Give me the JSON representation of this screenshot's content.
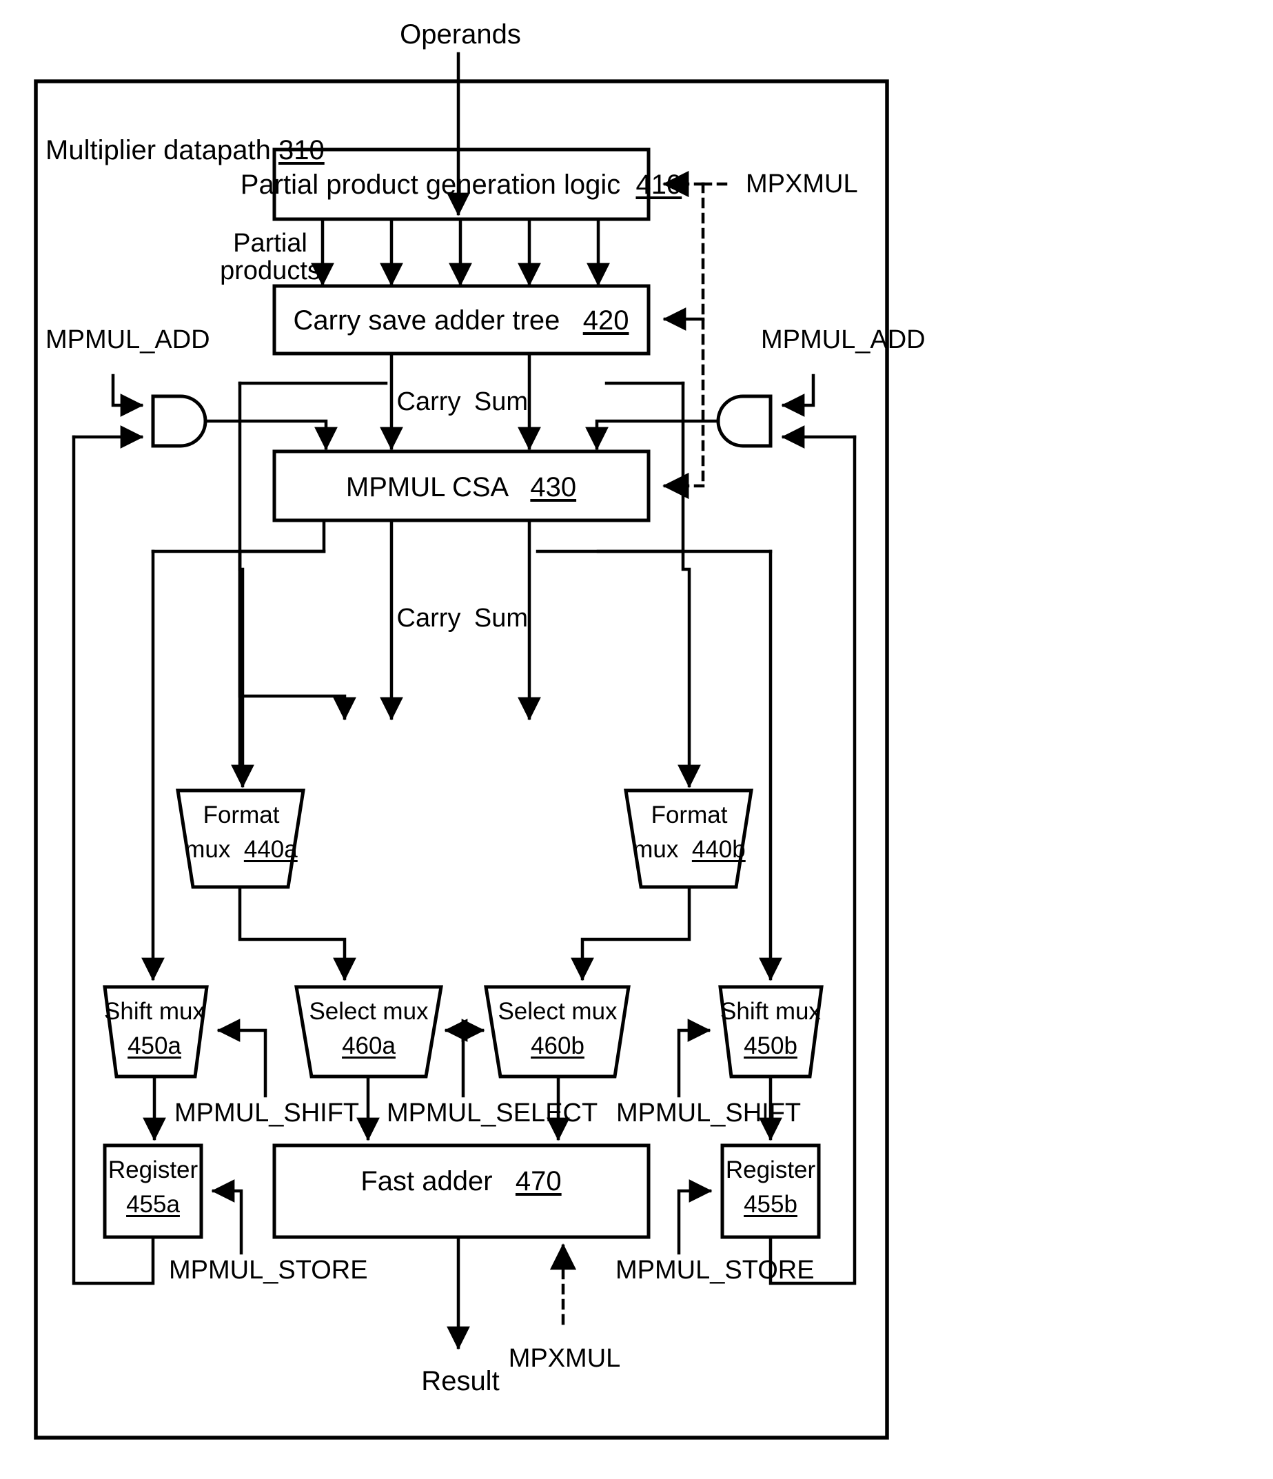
{
  "figure": {
    "title_block_label": "Multiplier datapath 310",
    "outer_label_text": "Multiplier datapath",
    "outer_label_ref": "310",
    "input_label": "Operands",
    "output_label": "Result"
  },
  "blocks": {
    "ppg": {
      "text": "Partial product generation logic",
      "ref": "410",
      "shape": "rect"
    },
    "csa_tree": {
      "text": "Carry save adder tree",
      "ref": "420",
      "shape": "rect"
    },
    "mpmul_csa": {
      "text": "MPMUL CSA",
      "ref": "430",
      "shape": "rect"
    },
    "format_mux_a": {
      "line1": "Format",
      "line2": "mux",
      "ref": "440a",
      "shape": "trapezoid"
    },
    "format_mux_b": {
      "line1": "Format",
      "line2": "mux",
      "ref": "440b",
      "shape": "trapezoid"
    },
    "shift_mux_a": {
      "line1": "Shift mux",
      "ref": "450a",
      "shape": "trapezoid"
    },
    "shift_mux_b": {
      "line1": "Shift mux",
      "ref": "450b",
      "shape": "trapezoid"
    },
    "select_mux_a": {
      "line1": "Select mux",
      "ref": "460a",
      "shape": "trapezoid"
    },
    "select_mux_b": {
      "line1": "Select mux",
      "ref": "460b",
      "shape": "trapezoid"
    },
    "register_a": {
      "line1": "Register",
      "ref": "455a",
      "shape": "rect"
    },
    "register_b": {
      "line1": "Register",
      "ref": "455b",
      "shape": "rect"
    },
    "fast_adder": {
      "text": "Fast adder",
      "ref": "470",
      "shape": "rect"
    },
    "and_gate_a": {
      "shape": "and-gate"
    },
    "and_gate_b": {
      "shape": "and-gate"
    }
  },
  "signals": {
    "mpxmul_top": "MPXMUL",
    "mpxmul_bottom": "MPXMUL",
    "mpmul_add_left": "MPMUL_ADD",
    "mpmul_add_right": "MPMUL_ADD",
    "mpmul_shift_left": "MPMUL_SHIFT",
    "mpmul_shift_right": "MPMUL_SHIFT",
    "mpmul_select": "MPMUL_SELECT",
    "mpmul_store_left": "MPMUL_STORE",
    "mpmul_store_right": "MPMUL_STORE"
  },
  "wire_labels": {
    "partial_products_l1": "Partial",
    "partial_products_l2": "products",
    "carry_upper": "Carry",
    "sum_upper": "Sum",
    "carry_lower": "Carry",
    "sum_lower": "Sum"
  },
  "colors": {
    "ink": "#000000",
    "paper": "#ffffff"
  }
}
